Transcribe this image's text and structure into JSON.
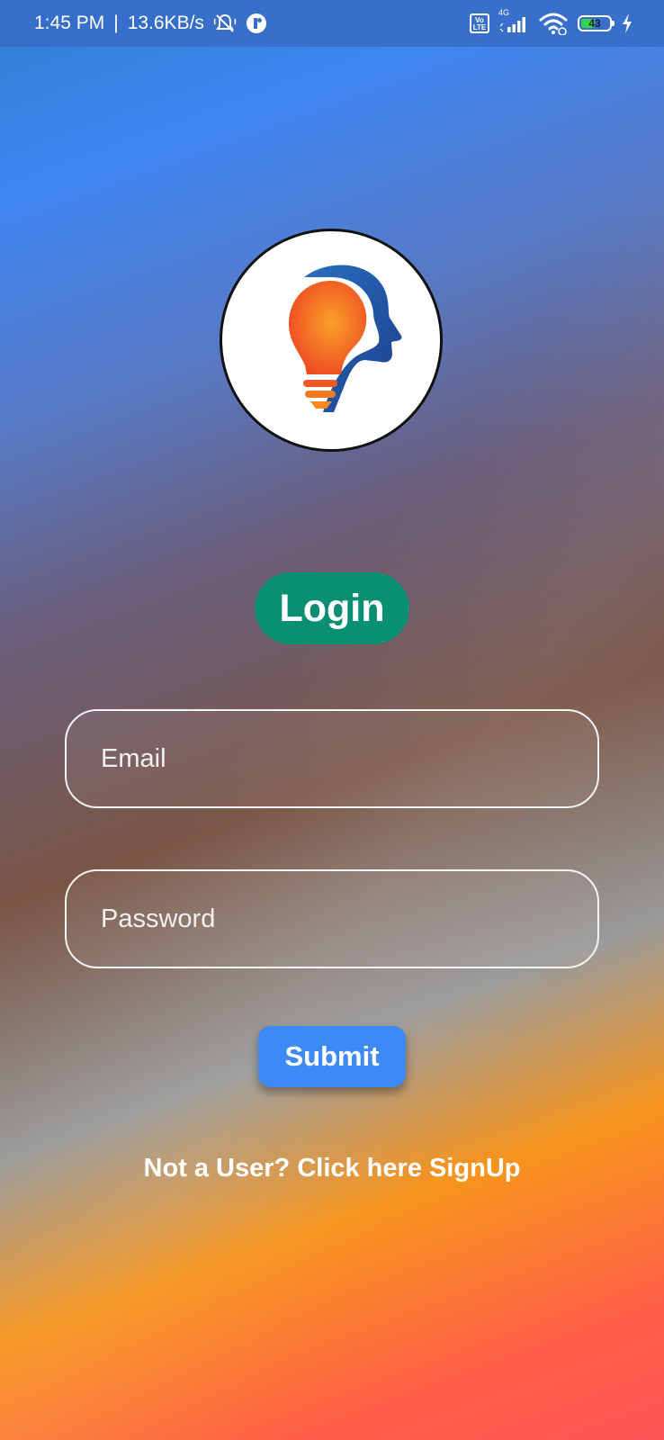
{
  "status_bar": {
    "time": "1:45 PM",
    "separator": "|",
    "speed": "13.6KB/s",
    "network_type": "4G",
    "volte_top": "Vo",
    "volte_bottom": "LTE",
    "battery_level": "43",
    "icons": [
      "silent-bell-icon",
      "app-notification-icon",
      "volte-icon",
      "signal-icon",
      "wifi-icon",
      "battery-icon",
      "charging-icon"
    ]
  },
  "logo": {
    "icon": "head-lightbulb-logo"
  },
  "login": {
    "title": "Login",
    "title_color": "#0a8f73"
  },
  "form": {
    "email_placeholder": "Email",
    "email_value": "",
    "password_placeholder": "Password",
    "password_value": "",
    "submit_label": "Submit",
    "submit_color": "#3d8af7"
  },
  "signup": {
    "text": "Not a User? Click here SignUp"
  }
}
